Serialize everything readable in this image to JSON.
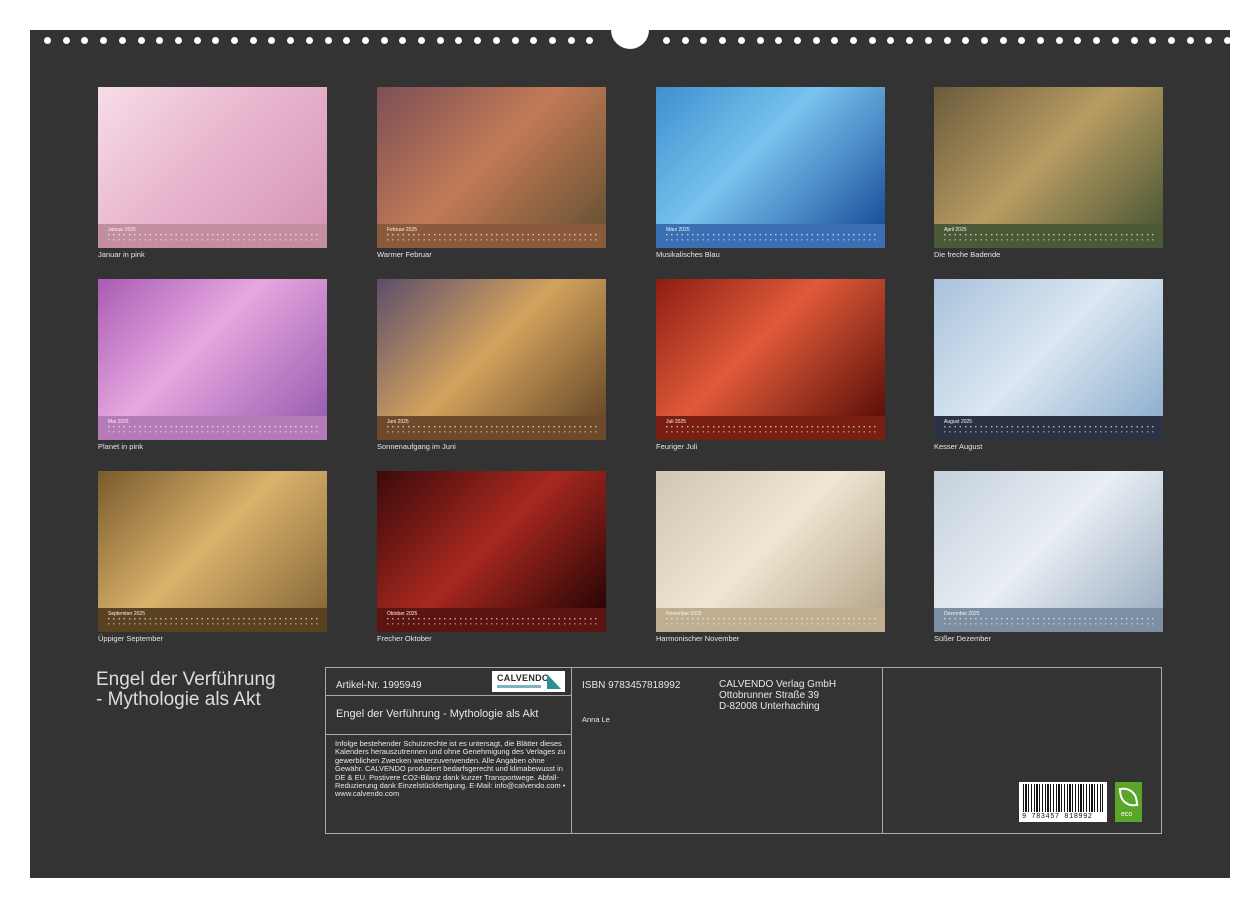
{
  "calendar": {
    "title_line1": "Engel der Verführung",
    "title_line2": "- Mythologie als Akt",
    "months": [
      {
        "label": "Januar 2025",
        "caption": "Januar in pink",
        "bg": "linear-gradient(135deg,#f7dde8 0%,#e9b8cf 45%,#d697b6 100%)",
        "strip": "#c48ea2"
      },
      {
        "label": "Februar 2025",
        "caption": "Warmer Februar",
        "bg": "linear-gradient(135deg,#7d4f57 0%,#c17a55 50%,#6a5334 100%)",
        "strip": "#8a5a3a"
      },
      {
        "label": "März 2025",
        "caption": "Musikalisches Blau",
        "bg": "linear-gradient(135deg,#3f8fcf 0%,#78c3ee 45%,#1b4f9c 100%)",
        "strip": "#3a6fb4"
      },
      {
        "label": "April 2025",
        "caption": "Die freche Badende",
        "bg": "linear-gradient(135deg,#6b5a3c 0%,#b89c62 50%,#4f5a36 100%)",
        "strip": "#4a5a36"
      },
      {
        "label": "Mai 2025",
        "caption": "Planet in pink",
        "bg": "linear-gradient(135deg,#a85cb3 0%,#e7a7e0 45%,#9a5fb2 100%)",
        "strip": "#b57bb9"
      },
      {
        "label": "Juni 2025",
        "caption": "Sonnenaufgang im Juni",
        "bg": "linear-gradient(135deg,#5c4d6b 0%,#d3a35d 50%,#6a4a2a 100%)",
        "strip": "#6e4a2a"
      },
      {
        "label": "Juli 2025",
        "caption": "Feuriger Juli",
        "bg": "linear-gradient(135deg,#8c1d12 0%,#e05a3a 45%,#5c1008 100%)",
        "strip": "#7a1e12"
      },
      {
        "label": "August 2025",
        "caption": "Kesser August",
        "bg": "linear-gradient(135deg,#a8c2db 0%,#dbe7f2 50%,#8fb0cf 100%)",
        "strip": "#2b3243"
      },
      {
        "label": "September 2025",
        "caption": "Üppiger September",
        "bg": "linear-gradient(135deg,#7a5a2d 0%,#d9b26b 50%,#8a6a3a 100%)",
        "strip": "#5a4120"
      },
      {
        "label": "Oktober 2025",
        "caption": "Frecher Oktober",
        "bg": "linear-gradient(135deg,#3a0a0a 0%,#a8281f 50%,#2a0505 100%)",
        "strip": "#5c1410"
      },
      {
        "label": "November 2025",
        "caption": "Harmonischer November",
        "bg": "linear-gradient(135deg,#cfc6b2 0%,#efe6d2 50%,#b8a98e 100%)",
        "strip": "#bfae8f"
      },
      {
        "label": "Dezember 2025",
        "caption": "Süßer Dezember",
        "bg": "linear-gradient(135deg,#c4d0dc 0%,#e8eef3 50%,#9fb0c3 100%)",
        "strip": "#7d8fa3"
      }
    ]
  },
  "info": {
    "article_label": "Artikel-Nr. 1995949",
    "logo_text": "CALVENDO",
    "isbn": "ISBN 9783457818992",
    "publisher_name": "CALVENDO Verlag GmbH",
    "publisher_street": "Ottobrunner Straße 39",
    "publisher_city": "D-82008 Unterhaching",
    "product_title": "Engel der Verführung - Mythologie als Akt",
    "author": "Anna Le",
    "legal_text": "Infolge bestehender Schutzrechte ist es untersagt, die Blätter dieses Kalenders herauszutrennen und ohne Genehmigung des Verlages zu gewerblichen Zwecken weiterzuverwenden. Alle Angaben ohne Gewähr. CALVENDO produziert bedarfsgerecht und klimabewusst in DE & EU. Postivere CO2-Bilanz dank kurzer Transportwege. Abfall-Reduzierung dank Einzelstückfertigung. E-Mail: info@calvendo.com • www.calvendo.com",
    "barcode_number": "9 783457 818992",
    "eco_label": "eco"
  }
}
